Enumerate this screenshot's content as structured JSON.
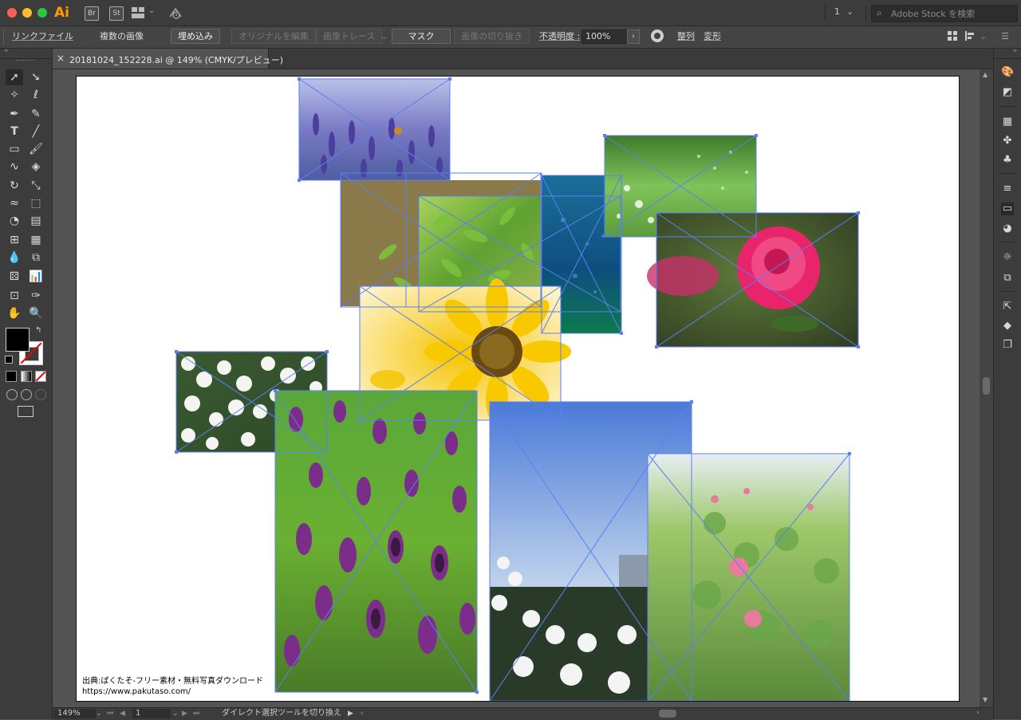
{
  "titlebar": {
    "app_logo": "Ai",
    "bridge_label": "Br",
    "stock_label": "St",
    "workspace_icon": "grid-layout-icon",
    "sync_icon": "sync-icon",
    "page_number": "1",
    "search_placeholder": "Adobe Stock を検索"
  },
  "controlbar": {
    "linked_file": "リンクファイル",
    "multiple_images": "複数の画像",
    "embed": "埋め込み",
    "edit_original": "オリジナルを編集",
    "image_trace": "画像トレース",
    "mask": "マスク",
    "crop_image": "画像の切り抜き",
    "opacity_label": "不透明度 :",
    "opacity_value": "100%",
    "align": "整列",
    "transform": "変形"
  },
  "document_tab": {
    "close_symbol": "×",
    "title": "20181024_152228.ai @ 149% (CMYK/プレビュー)"
  },
  "artboard": {
    "credit_line1": "出典:ぱくたそ-フリー素材・無料写真ダウンロード",
    "credit_line2": "https://www.pakutaso.com/",
    "images": [
      {
        "name": "lavender-photo",
        "subject": "lavender"
      },
      {
        "name": "green-leaves-photo",
        "subject": "leaves"
      },
      {
        "name": "water-drops-photo",
        "subject": "blue drops"
      },
      {
        "name": "meadow-photo",
        "subject": "meadow"
      },
      {
        "name": "pink-rose-photo",
        "subject": "rose"
      },
      {
        "name": "sunflower-photo",
        "subject": "sunflower"
      },
      {
        "name": "white-flowers-photo",
        "subject": "white flowers"
      },
      {
        "name": "purple-lavender-field-photo",
        "subject": "lavender field"
      },
      {
        "name": "white-garden-sky-photo",
        "subject": "garden"
      },
      {
        "name": "pink-roses-bush-photo",
        "subject": "rose bush"
      }
    ]
  },
  "statusbar": {
    "zoom": "149%",
    "page": "1",
    "status_text": "ダイレクト選択ツールを切り換え"
  },
  "colors": {
    "selection": "#5b7ff5",
    "app_bg": "#535353",
    "panel_bg": "#3c3c3c",
    "logo": "#ff9a00"
  }
}
